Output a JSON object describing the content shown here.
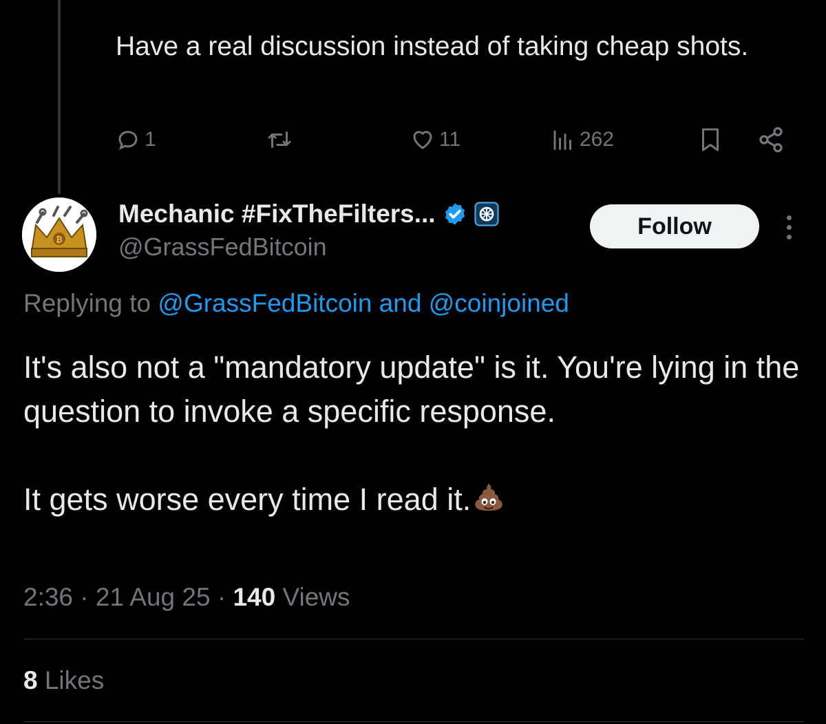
{
  "parent_tweet": {
    "text": "Have a real discussion instead of taking cheap shots.",
    "actions": {
      "replies": "1",
      "retweets": "",
      "likes": "11",
      "views": "262"
    }
  },
  "tweet": {
    "display_name": "Mechanic #FixTheFilters...",
    "handle": "@GrassFedBitcoin",
    "follow_label": "Follow",
    "replying_prefix": "Replying to",
    "replying_user1": "@GrassFedBitcoin",
    "replying_and": "and",
    "replying_user2": "@coinjoined",
    "paragraph1": "It's also not a \"mandatory update\" is it. You're lying in the question to invoke a specific response.",
    "paragraph2": "It gets worse every time I read it.",
    "time": "2:36",
    "sep1": " · ",
    "date": "21 Aug 25",
    "sep2": " · ",
    "views_count": "140",
    "views_label": "Views",
    "likes_count": "8",
    "likes_label": "Likes"
  },
  "colors": {
    "background": "#000000",
    "text": "#e7e9ea",
    "secondary": "#71767b",
    "link": "#1d9bf0",
    "verified": "#1d9bf0"
  }
}
